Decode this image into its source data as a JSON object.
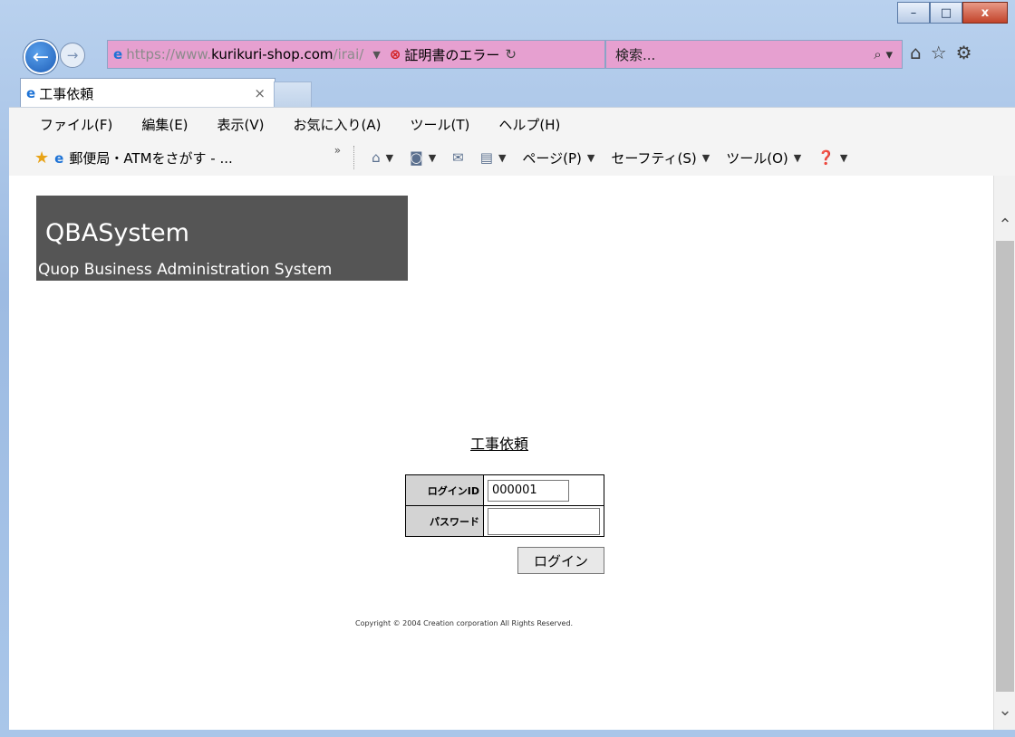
{
  "window": {
    "minimize": "–",
    "maximize": "□",
    "close": "x"
  },
  "nav": {
    "url_scheme": "https://www.",
    "url_host": "kurikuri-shop.com",
    "url_path": "/irai/",
    "cert_error": "証明書のエラー",
    "search_placeholder": "検索..."
  },
  "tab": {
    "title": "工事依頼"
  },
  "menu": {
    "file": "ファイル(F)",
    "edit": "編集(E)",
    "view": "表示(V)",
    "favorites": "お気に入り(A)",
    "tools": "ツール(T)",
    "help": "ヘルプ(H)"
  },
  "commandbar": {
    "favorite_link": "郵便局・ATMをさがす - ...",
    "page": "ページ(P)",
    "safety": "セーフティ(S)",
    "tools": "ツール(O)"
  },
  "page": {
    "banner_title": "QBASystem",
    "banner_subtitle": "Quop Business Administration System",
    "heading": "工事依頼",
    "login_id_label": "ログインID",
    "login_id_value": "000001",
    "password_label": "パスワード",
    "login_button": "ログイン",
    "copyright": "Copyright © 2004 Creation corporation All Rights Reserved."
  }
}
